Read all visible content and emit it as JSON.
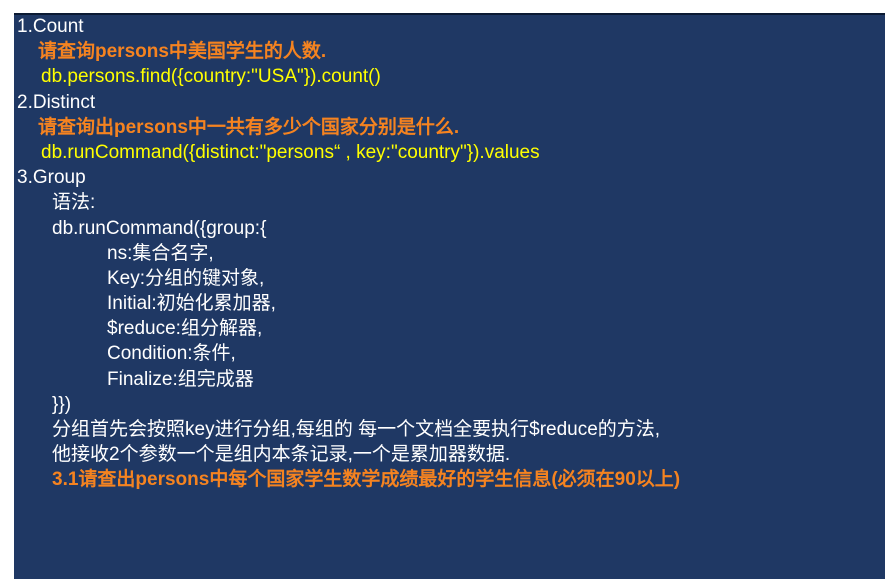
{
  "colors": {
    "background": "#1f3864",
    "text": "#ffffff",
    "question": "#f58320",
    "code": "#ffff00"
  },
  "lines": {
    "count_heading": "1.Count",
    "count_question": "请查询persons中美国学生的人数.",
    "count_code": "db.persons.find({country:\"USA\"}).count()",
    "distinct_heading": "2.Distinct",
    "distinct_question": "请查询出persons中一共有多少个国家分别是什么.",
    "distinct_code": "db.runCommand({distinct:\"persons“ , key:\"country\"}).values",
    "group_heading": "3.Group",
    "syntax_label": "语法:",
    "group_open": "db.runCommand({group:{",
    "group_ns": "ns:集合名字,",
    "group_key": "Key:分组的键对象,",
    "group_initial": "Initial:初始化累加器,",
    "group_reduce": "$reduce:组分解器,",
    "group_condition": "Condition:条件,",
    "group_finalize": "Finalize:组完成器",
    "group_close": "}})",
    "desc_1": "分组首先会按照key进行分组,每组的 每一个文档全要执行$reduce的方法,",
    "desc_2": "他接收2个参数一个是组内本条记录,一个是累加器数据.",
    "group_question": "3.1请查出persons中每个国家学生数学成绩最好的学生信息(必须在90以上)"
  }
}
